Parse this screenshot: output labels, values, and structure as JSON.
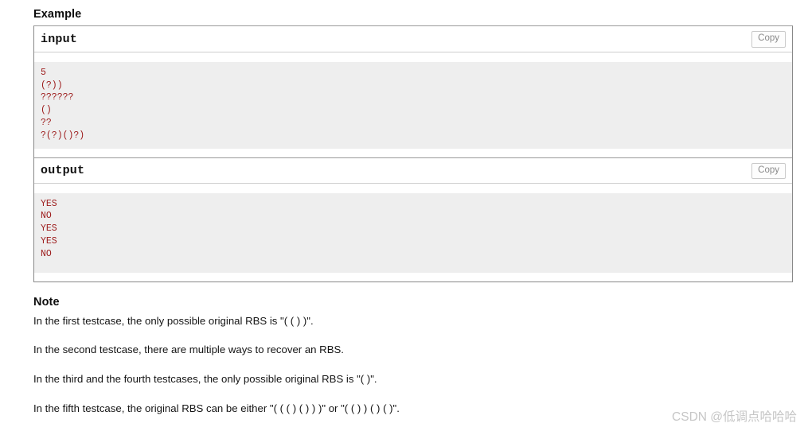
{
  "example": {
    "heading": "Example",
    "input_panel": {
      "title": "input",
      "copy_label": "Copy",
      "content": "5\n(?))\n??????\n()\n??\n?(?)()?)"
    },
    "output_panel": {
      "title": "output",
      "copy_label": "Copy",
      "content": "YES\nNO\nYES\nYES\nNO"
    }
  },
  "note": {
    "heading": "Note",
    "paragraphs": [
      "In the first testcase, the only possible original RBS is \"( ( ) )\".",
      "In the second testcase, there are multiple ways to recover an RBS.",
      "In the third and the fourth testcases, the only possible original RBS is \"( )\".",
      "In the fifth testcase, the original RBS can be either \"( ( ( ) ( ) ) )\" or \"( ( ) ) ( ) ( )\"."
    ]
  },
  "watermark": {
    "text": "CSDN @低调点哈哈哈"
  },
  "colors": {
    "code_text": "#9c1a1a",
    "code_background": "#eeeeee",
    "panel_border": "#888888",
    "copy_text": "#8a8a8a",
    "watermark": "#c6c6c6"
  }
}
